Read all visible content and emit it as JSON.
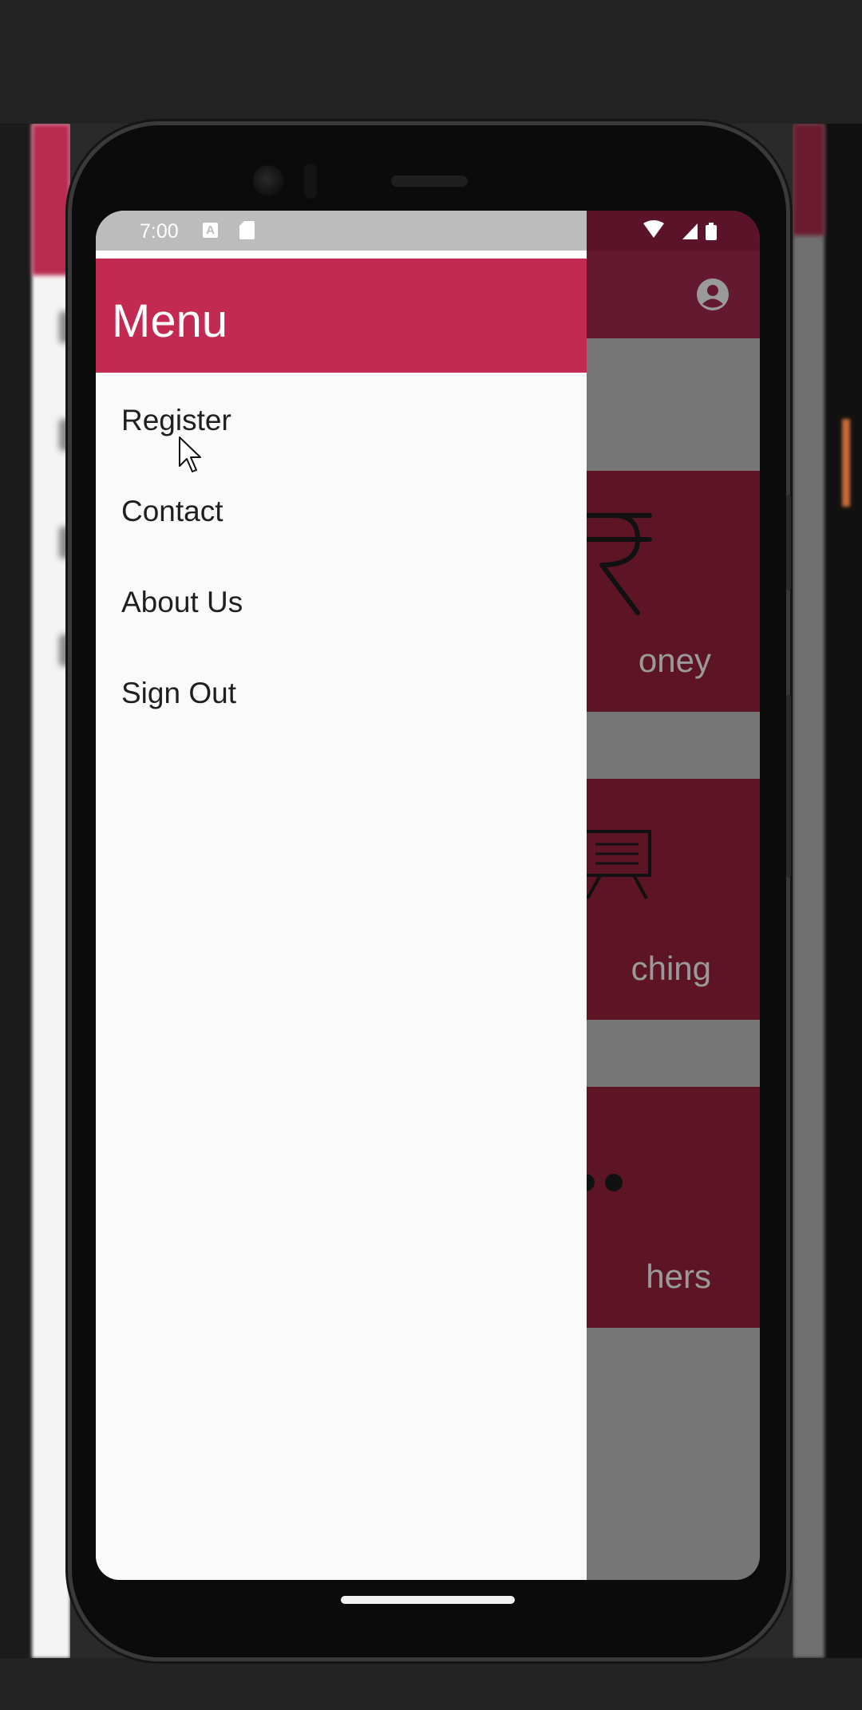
{
  "status_bar": {
    "time": "7:00",
    "notification_icons": [
      "a-icon",
      "sd-card-icon"
    ],
    "system_icons": [
      "wifi-icon",
      "signal-icon",
      "battery-icon"
    ]
  },
  "drawer": {
    "title": "Menu",
    "items": [
      {
        "label": "Register",
        "icon": "none"
      },
      {
        "label": "Contact",
        "icon": "none"
      },
      {
        "label": "About Us",
        "icon": "none"
      },
      {
        "label": "Sign Out",
        "icon": "none"
      }
    ]
  },
  "background_app": {
    "account_icon": "account-circle-icon",
    "cards": [
      {
        "label_visible": "oney",
        "icon": "rupee-icon"
      },
      {
        "label_visible": "ching",
        "icon": "presentation-board-icon"
      },
      {
        "label_visible": "hers",
        "icon": "more-dots-icon"
      }
    ]
  },
  "colors": {
    "drawer_header": "#c22a51",
    "drawer_background": "#fafafa",
    "scrim_card": "#5d1526",
    "scrim": "#767676",
    "app_bar_dimmed": "#631a30"
  }
}
